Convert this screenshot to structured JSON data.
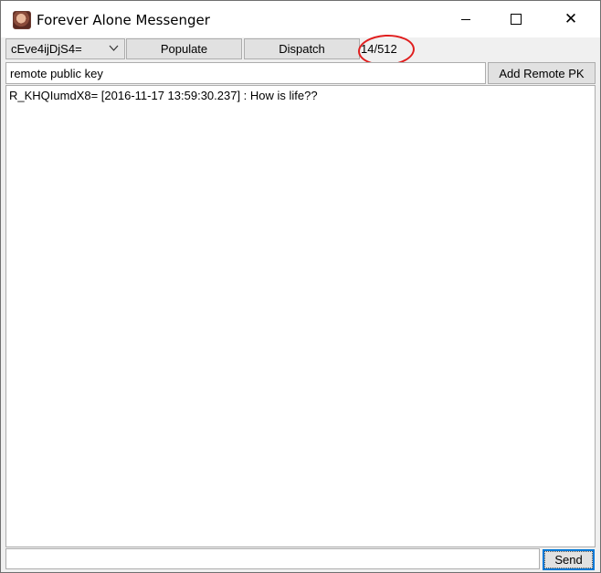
{
  "window": {
    "title": "Forever Alone Messenger",
    "minimize_glyph": "",
    "close_glyph": "✕"
  },
  "toolbar": {
    "key_select_value": "cEve4ijDjS4=",
    "populate_label": "Populate",
    "dispatch_label": "Dispatch",
    "counter_text": "14/512",
    "annotation_color": "#e01e1e"
  },
  "remote_pk": {
    "input_value": "remote public key",
    "add_button_label": "Add Remote PK"
  },
  "messages": [
    {
      "text": "R_KHQIumdX8= [2016-11-17 13:59:30.237] : How is life??"
    }
  ],
  "compose": {
    "value": "",
    "send_label": "Send"
  }
}
